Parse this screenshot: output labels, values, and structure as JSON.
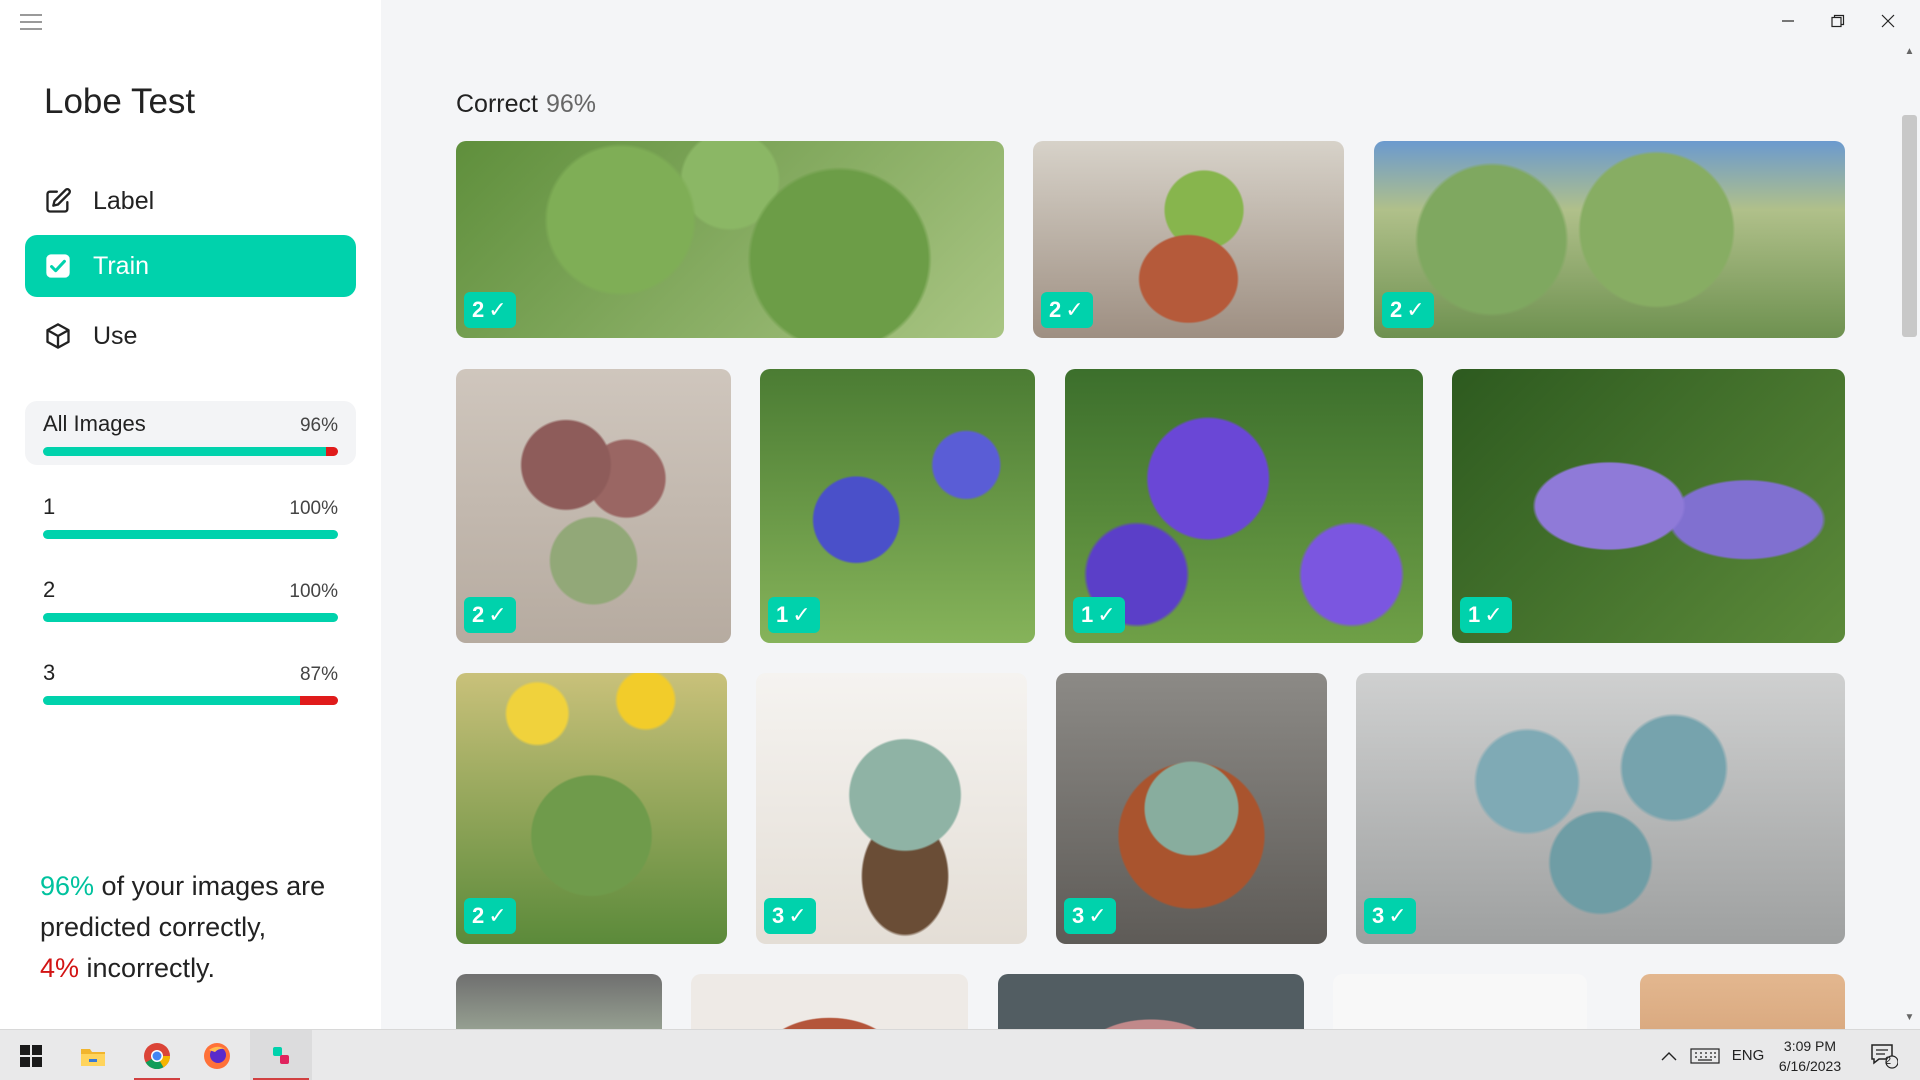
{
  "app": {
    "title": "Lobe Test"
  },
  "nav": [
    {
      "label": "Label",
      "icon": "edit-icon"
    },
    {
      "label": "Train",
      "icon": "check-square-icon",
      "active": true
    },
    {
      "label": "Use",
      "icon": "cube-icon"
    }
  ],
  "stats": {
    "all": {
      "name": "All Images",
      "pct": "96%",
      "value": 0.96
    },
    "labels": [
      {
        "name": "1",
        "pct": "100%",
        "value": 1.0
      },
      {
        "name": "2",
        "pct": "100%",
        "value": 1.0
      },
      {
        "name": "3",
        "pct": "87%",
        "value": 0.87
      }
    ]
  },
  "summary": {
    "correct_pct": "96%",
    "correct_text": " of your images are predicted correctly,",
    "incorrect_pct": "4%",
    "incorrect_text": " incorrectly."
  },
  "main": {
    "section_title": "Correct",
    "section_pct": "96%",
    "images": [
      {
        "label": "2",
        "subject": "cactus"
      },
      {
        "label": "2",
        "subject": "potted cactus"
      },
      {
        "label": "2",
        "subject": "prickly pear cactus"
      },
      {
        "label": "2",
        "subject": "red bunny ear cactus"
      },
      {
        "label": "1",
        "subject": "iris"
      },
      {
        "label": "1",
        "subject": "iris field"
      },
      {
        "label": "1",
        "subject": "iris closeup"
      },
      {
        "label": "2",
        "subject": "cactus with yellow flowers"
      },
      {
        "label": "3",
        "subject": "succulent in hand"
      },
      {
        "label": "3",
        "subject": "succulent in pot"
      },
      {
        "label": "3",
        "subject": "succulent cluster"
      }
    ]
  },
  "colors": {
    "accent": "#00d2ac",
    "error": "#e01b1b"
  },
  "taskbar": {
    "apps": [
      "windows-start-icon",
      "file-explorer-icon",
      "chrome-icon",
      "firefox-icon",
      "lobe-icon"
    ],
    "language": "ENG",
    "time": "3:09 PM",
    "date": "6/16/2023",
    "notifications": "2"
  }
}
